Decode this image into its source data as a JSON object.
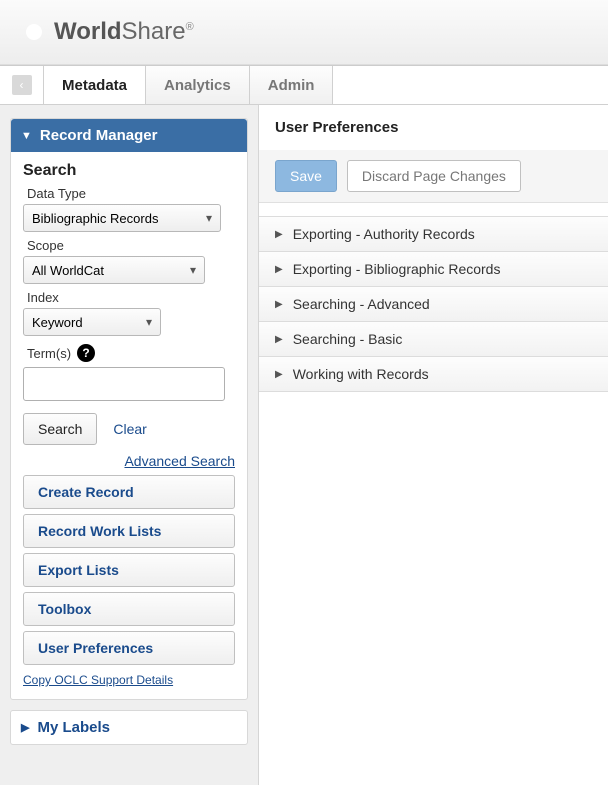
{
  "brand": {
    "name_part1": "World",
    "name_part2": "Share",
    "registered": "®"
  },
  "tabs": [
    {
      "label": "Metadata",
      "active": true
    },
    {
      "label": "Analytics",
      "active": false
    },
    {
      "label": "Admin",
      "active": false
    }
  ],
  "sidebar": {
    "record_manager": {
      "title": "Record Manager",
      "search_heading": "Search",
      "data_type_label": "Data Type",
      "data_type_value": "Bibliographic Records",
      "scope_label": "Scope",
      "scope_value": "All WorldCat",
      "index_label": "Index",
      "index_value": "Keyword",
      "terms_label": "Term(s)",
      "terms_value": "",
      "search_button": "Search",
      "clear_link": "Clear",
      "advanced_search": "Advanced Search",
      "nav": [
        "Create Record",
        "Record Work Lists",
        "Export Lists",
        "Toolbox",
        "User Preferences"
      ],
      "copy_support": "Copy OCLC Support Details"
    },
    "my_labels": {
      "title": "My Labels"
    }
  },
  "content": {
    "title": "User Preferences",
    "save": "Save",
    "discard": "Discard Page Changes",
    "sections": [
      "Exporting - Authority Records",
      "Exporting - Bibliographic Records",
      "Searching - Advanced",
      "Searching - Basic",
      "Working with Records"
    ]
  }
}
